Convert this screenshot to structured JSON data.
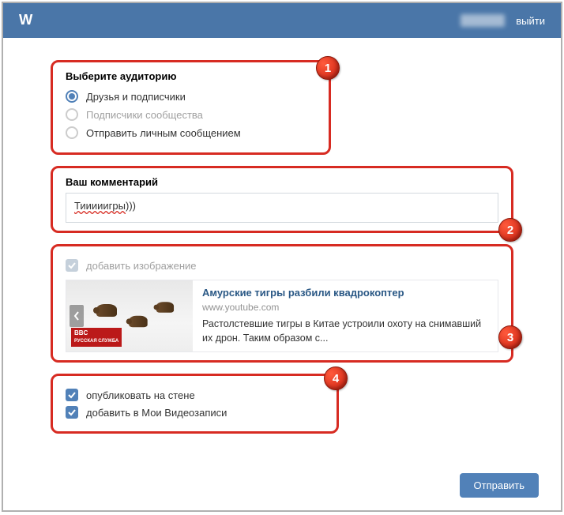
{
  "header": {
    "logout": "выйти"
  },
  "audience": {
    "title": "Выберите аудиторию",
    "options": [
      "Друзья и подписчики",
      "Подписчики сообщества",
      "Отправить личным сообщением"
    ]
  },
  "comment": {
    "label": "Ваш комментарий",
    "value_misspelled": "Тииииигры",
    "value_suffix": ")))"
  },
  "attach": {
    "add_image_label": "добавить изображение",
    "preview": {
      "title": "Амурские тигры разбили квадрокоптер",
      "domain": "www.youtube.com",
      "description": "Растолстевшие тигры в Китае устроили охоту на снимавший их дрон. Таким образом с...",
      "badge_line1": "BBC",
      "badge_line2": "РУССКАЯ СЛУЖБА"
    }
  },
  "options": {
    "publish_wall": "опубликовать на стене",
    "add_my_videos": "добавить в Мои Видеозаписи"
  },
  "submit": "Отправить",
  "badges": {
    "b1": "1",
    "b2": "2",
    "b3": "3",
    "b4": "4"
  }
}
